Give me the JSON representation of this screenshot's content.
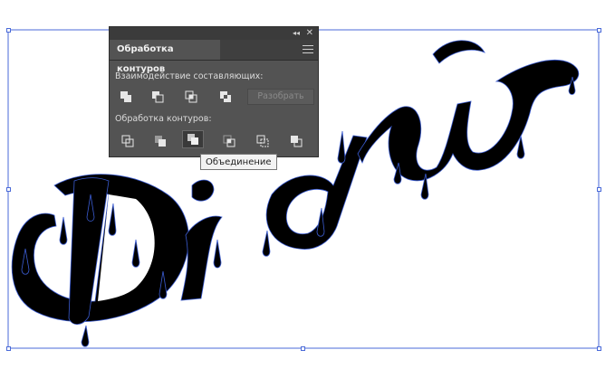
{
  "panel": {
    "tab_label": "Обработка контуров",
    "shape_modes_label": "Взаимодействие составляющих:",
    "expand_label": "Разобрать",
    "pathfinders_label": "Обработка контуров:",
    "shape_mode_icons": [
      "unite-icon",
      "minus-front-icon",
      "intersect-icon",
      "exclude-icon"
    ],
    "pathfinder_icons": [
      "divide-icon",
      "trim-icon",
      "merge-icon",
      "crop-icon",
      "outline-icon",
      "minus-back-icon"
    ]
  },
  "tooltip": {
    "text": "Объединение"
  },
  "artwork": {
    "text": "Draw"
  },
  "colors": {
    "panel_bg": "#535353",
    "selection": "#4a6ad8",
    "artwork_fill": "#000000"
  }
}
